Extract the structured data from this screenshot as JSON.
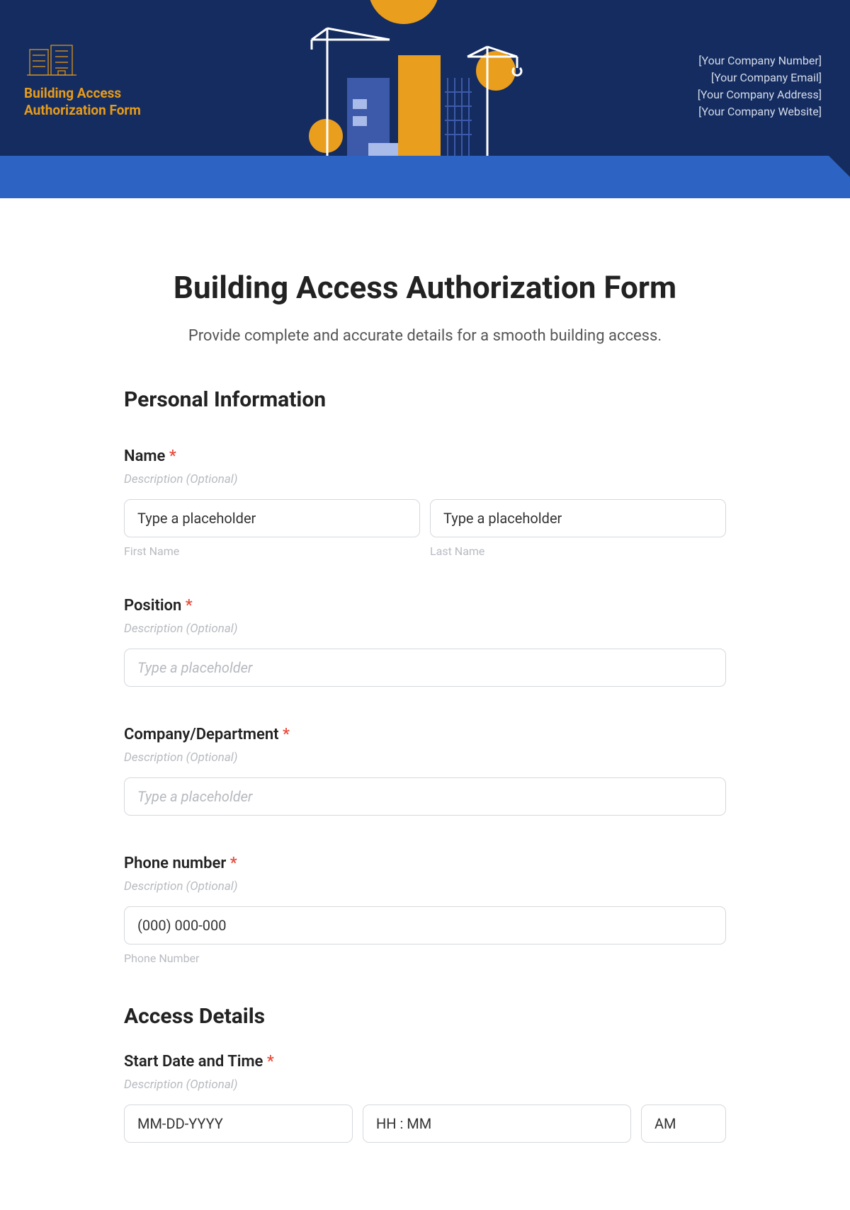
{
  "header": {
    "logo_title_line1": "Building Access",
    "logo_title_line2": "Authorization Form",
    "company": {
      "number": "[Your Company Number]",
      "email": "[Your Company Email]",
      "address": "[Your Company Address]",
      "website": "[Your Company Website]"
    }
  },
  "page": {
    "title": "Building Access Authorization Form",
    "subtitle": "Provide complete and accurate details for a smooth building access."
  },
  "sections": {
    "personal": {
      "heading": "Personal Information",
      "name": {
        "label": "Name",
        "desc": "Description (Optional)",
        "first_placeholder": "Type a placeholder",
        "last_placeholder": "Type a placeholder",
        "first_sublabel": "First Name",
        "last_sublabel": "Last Name"
      },
      "position": {
        "label": "Position",
        "desc": "Description (Optional)",
        "placeholder": "Type a placeholder"
      },
      "company": {
        "label": "Company/Department",
        "desc": "Description (Optional)",
        "placeholder": "Type a placeholder"
      },
      "phone": {
        "label": "Phone number",
        "desc": "Description (Optional)",
        "placeholder": "(000) 000-000",
        "sublabel": "Phone Number"
      }
    },
    "access": {
      "heading": "Access Details",
      "start": {
        "label": "Start Date and Time",
        "desc": "Description (Optional)",
        "date_placeholder": "MM-DD-YYYY",
        "time_placeholder": "HH : MM",
        "ampm": "AM"
      }
    }
  },
  "required_marker": "*"
}
